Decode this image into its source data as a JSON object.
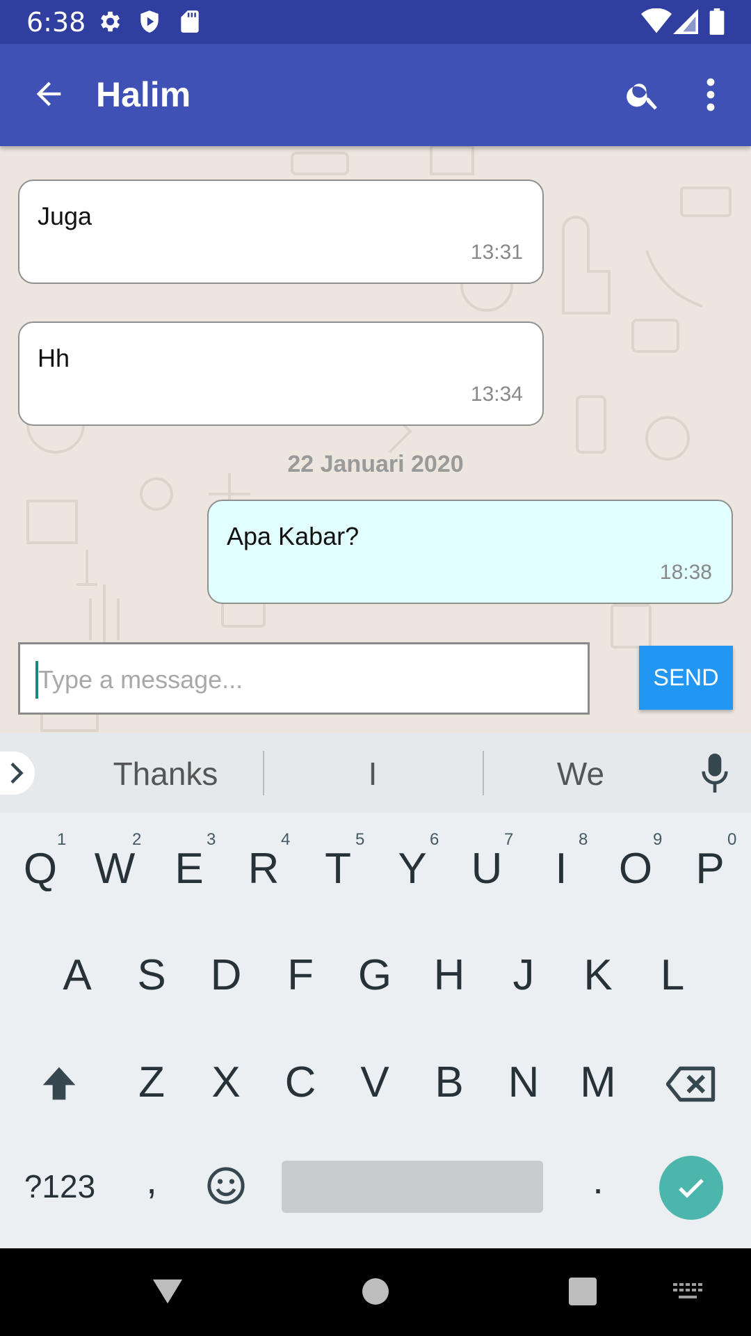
{
  "status_bar": {
    "time": "6:38",
    "icons": [
      "settings-icon",
      "shield-play-icon",
      "sd-card-icon",
      "wifi-icon",
      "signal-icon",
      "battery-icon"
    ]
  },
  "app_bar": {
    "title": "Halim",
    "icons": [
      "back-arrow-icon",
      "search-icon",
      "more-vert-icon"
    ],
    "color": "#3f51b5",
    "status_color": "#303f9f"
  },
  "chat": {
    "messages": [
      {
        "direction": "in",
        "text": "Juga",
        "time": "13:31"
      },
      {
        "direction": "in",
        "text": "Hh",
        "time": "13:34"
      },
      {
        "direction": "out",
        "text": "Apa Kabar?",
        "time": "18:38"
      }
    ],
    "date_separator": "22 Januari 2020",
    "input": {
      "placeholder": "Type a message...",
      "value": ""
    },
    "send_label": "SEND",
    "send_color": "#2196f3",
    "outgoing_bubble_color": "#e1fffe"
  },
  "keyboard": {
    "suggestions": [
      "Thanks",
      "I",
      "We"
    ],
    "row1": [
      "Q",
      "W",
      "E",
      "R",
      "T",
      "Y",
      "U",
      "I",
      "O",
      "P"
    ],
    "row1_hints": [
      "1",
      "2",
      "3",
      "4",
      "5",
      "6",
      "7",
      "8",
      "9",
      "0"
    ],
    "row2": [
      "A",
      "S",
      "D",
      "F",
      "G",
      "H",
      "J",
      "K",
      "L"
    ],
    "row3": [
      "Z",
      "X",
      "C",
      "V",
      "B",
      "N",
      "M"
    ],
    "symbols_label": "?123",
    "comma": ",",
    "period": ".",
    "enter_color": "#4db6ac"
  },
  "nav_bar": {
    "icons": [
      "back-triangle-icon",
      "home-circle-icon",
      "recents-square-icon",
      "keyboard-switch-icon"
    ]
  }
}
